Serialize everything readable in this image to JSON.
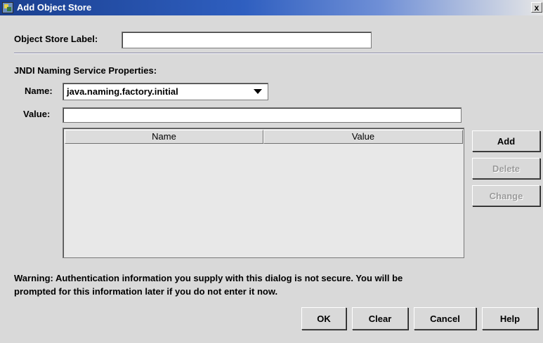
{
  "window": {
    "title": "Add Object Store",
    "close_glyph": "x",
    "icon": "object-store-icon"
  },
  "object_store": {
    "label": "Object Store Label:",
    "value": ""
  },
  "jndi": {
    "section_title": "JNDI Naming Service Properties:",
    "name_label": "Name:",
    "name_selected": "java.naming.factory.initial",
    "value_label": "Value:",
    "value": ""
  },
  "table": {
    "columns": [
      "Name",
      "Value"
    ],
    "rows": []
  },
  "side_buttons": {
    "add": "Add",
    "delete": "Delete",
    "change": "Change"
  },
  "warning": {
    "line1": "Warning: Authentication information you supply with this dialog is not secure. You will be",
    "line2": "prompted for this information later if you do not enter it now."
  },
  "footer_buttons": {
    "ok": "OK",
    "clear": "Clear",
    "cancel": "Cancel",
    "help": "Help"
  },
  "colors": {
    "title_bar": "#1a3f8f",
    "dialog_bg": "#d9d9d9",
    "disabled_text": "#9a9a9a"
  }
}
